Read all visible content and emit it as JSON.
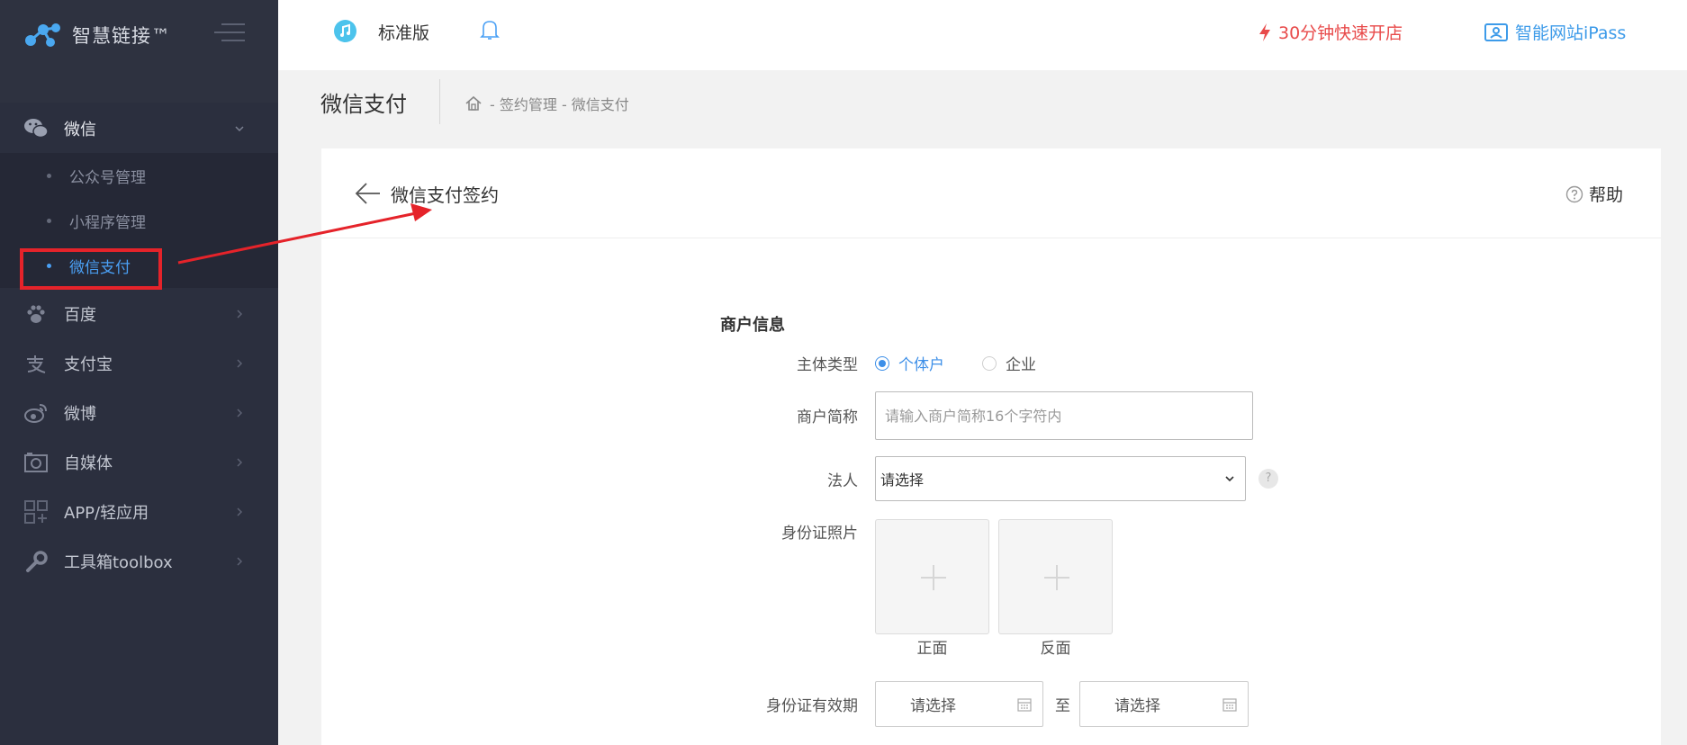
{
  "brand": {
    "name": "智慧链接™"
  },
  "sidebar": {
    "items": [
      {
        "label": "微信",
        "icon": "wechat-icon",
        "expanded": true,
        "children": [
          {
            "label": "公众号管理",
            "active": false
          },
          {
            "label": "小程序管理",
            "active": false
          },
          {
            "label": "微信支付",
            "active": true
          }
        ]
      },
      {
        "label": "百度",
        "icon": "paw-icon"
      },
      {
        "label": "支付宝",
        "icon": "alipay-icon"
      },
      {
        "label": "微博",
        "icon": "weibo-icon"
      },
      {
        "label": "自媒体",
        "icon": "camera-icon"
      },
      {
        "label": "APP/轻应用",
        "icon": "app-grid-icon"
      },
      {
        "label": "工具箱toolbox",
        "icon": "wrench-icon"
      }
    ]
  },
  "topbar": {
    "edition": "标准版",
    "open_store": "30分钟快速开店",
    "ipass": "智能网站iPass"
  },
  "page": {
    "title": "微信支付",
    "breadcrumb": "- 签约管理 - 微信支付"
  },
  "card": {
    "title": "微信支付签约",
    "help": "帮助"
  },
  "form": {
    "section": "商户信息",
    "subject_type": {
      "label": "主体类型",
      "options": [
        "个体户",
        "企业"
      ],
      "selected": "个体户"
    },
    "short_name": {
      "label": "商户简称",
      "placeholder": "请输入商户简称16个字符内"
    },
    "legal_person": {
      "label": "法人",
      "value": "请选择",
      "help": "?"
    },
    "id_photos": {
      "label": "身份证照片",
      "front": "正面",
      "back": "反面"
    },
    "id_validity": {
      "label": "身份证有效期",
      "start": "请选择",
      "to": "至",
      "end": "请选择"
    }
  },
  "colors": {
    "sidebar_bg": "#2b2f3e",
    "accent": "#3d8fe8",
    "promo_red": "#e84a4a",
    "annotation_red": "#e5232a"
  }
}
